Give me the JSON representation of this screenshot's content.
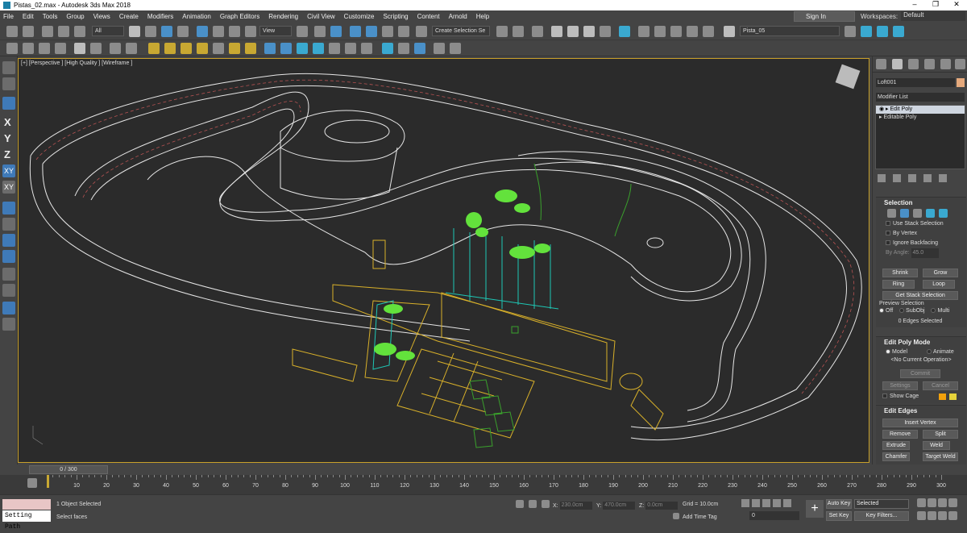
{
  "window": {
    "title": "Pistas_02.max - Autodesk 3ds Max 2018"
  },
  "menu": [
    "File",
    "Edit",
    "Tools",
    "Group",
    "Views",
    "Create",
    "Modifiers",
    "Animation",
    "Graph Editors",
    "Rendering",
    "Civil View",
    "Customize",
    "Scripting",
    "Content",
    "Arnold",
    "Help"
  ],
  "account": {
    "signin": "Sign In",
    "workspaces_label": "Workspaces:",
    "workspace": "Default"
  },
  "toolbar": {
    "filter": "All",
    "refcoord": "View",
    "selection_set": "Create Selection Se",
    "layer": "Pista_05"
  },
  "viewport": {
    "label": "[+] [Perspective ] [High Quality ] [Wireframe ]"
  },
  "left_axes": [
    "X",
    "Y",
    "Z",
    "XY",
    "XY"
  ],
  "command_panel": {
    "object_name": "Loft001",
    "modifier_list": "Modifier List",
    "stack": [
      {
        "label": "Edit Poly"
      },
      {
        "label": "Editable Poly"
      }
    ],
    "selection": {
      "title": "Selection",
      "use_stack": "Use Stack Selection",
      "by_vertex": "By Vertex",
      "ignore_backfacing": "Ignore Backfacing",
      "by_angle": "By Angle:",
      "angle_value": "45.0",
      "shrink": "Shrink",
      "grow": "Grow",
      "ring": "Ring",
      "loop": "Loop",
      "get_stack": "Get Stack Selection",
      "preview": "Preview Selection",
      "off": "Off",
      "subobj": "SubObj",
      "multi": "Multi",
      "count": "0 Edges Selected"
    },
    "edit_poly_mode": {
      "title": "Edit Poly Mode",
      "model": "Model",
      "animate": "Animate",
      "operation": "<No Current Operation>",
      "commit": "Commit",
      "settings": "Settings",
      "cancel": "Cancel",
      "show_cage": "Show Cage"
    },
    "edit_edges": {
      "title": "Edit Edges",
      "insert_vertex": "Insert Vertex",
      "remove": "Remove",
      "split": "Split",
      "extrude": "Extrude",
      "weld": "Weld",
      "chamfer": "Chamfer",
      "target_weld": "Target Weld"
    }
  },
  "timeline": {
    "frame": "0 / 300",
    "ticks": [
      "0",
      "10",
      "20",
      "30",
      "40",
      "50",
      "60",
      "70",
      "80",
      "90",
      "100",
      "110",
      "120",
      "130",
      "140",
      "150",
      "160",
      "170",
      "180",
      "190",
      "200",
      "210",
      "220",
      "230",
      "240",
      "250",
      "260",
      "270",
      "280",
      "290",
      "300"
    ],
    "cursor_fraction": 0
  },
  "status": {
    "script_text": "Setting Path",
    "objects": "1 Object Selected",
    "prompt": "Select faces",
    "x_label": "X:",
    "x": "230.0cm",
    "y_label": "Y:",
    "y": "470.0cm",
    "z_label": "Z:",
    "z": "0.0cm",
    "grid": "Grid = 10.0cm",
    "add_time_tag": "Add Time Tag",
    "auto_key": "Auto Key",
    "set_key": "Set Key",
    "selected": "Selected",
    "key_filters": "Key Filters...",
    "current_frame": "0"
  },
  "colors": {
    "track_white": "#e8e8e8",
    "trees": "#63e23c",
    "cyan": "#1ec7b5",
    "yellow": "#d8b02a",
    "accent": "#3f7ab8"
  }
}
